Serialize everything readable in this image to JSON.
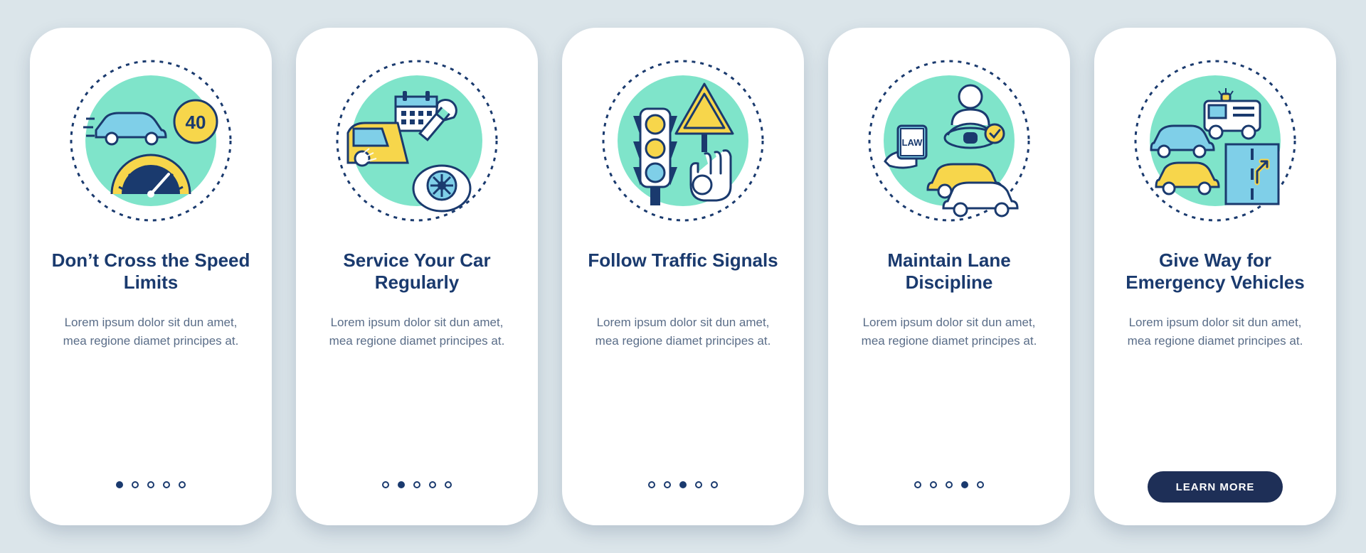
{
  "colors": {
    "accent": "#1a3a6e",
    "mint": "#7fe4ca",
    "yellow": "#f7d64b",
    "sky": "#7fcfe8"
  },
  "cta_label": "LEARN MORE",
  "cards": [
    {
      "id": "speed-limits",
      "icon": "speed-limit-icon",
      "title": "Don’t Cross the Speed Limits",
      "desc": "Lorem ipsum dolor sit dun amet, mea regione diamet principes at.",
      "active_index": 0
    },
    {
      "id": "service-car",
      "icon": "service-car-icon",
      "title": "Service Your Car Regularly",
      "desc": "Lorem ipsum dolor sit dun amet, mea regione diamet principes at.",
      "active_index": 1
    },
    {
      "id": "traffic-signals",
      "icon": "traffic-signals-icon",
      "title": "Follow Traffic Signals",
      "desc": "Lorem ipsum dolor sit dun amet, mea regione diamet principes at.",
      "active_index": 2
    },
    {
      "id": "lane-discipline",
      "icon": "lane-discipline-icon",
      "title": "Maintain Lane Discipline",
      "desc": "Lorem ipsum dolor sit dun amet, mea regione diamet principes at.",
      "active_index": 3
    },
    {
      "id": "emergency-vehicles",
      "icon": "emergency-vehicles-icon",
      "title": "Give Way for Emergency Vehicles",
      "desc": "Lorem ipsum dolor sit dun amet, mea regione diamet principes at.",
      "active_index": 4
    }
  ]
}
